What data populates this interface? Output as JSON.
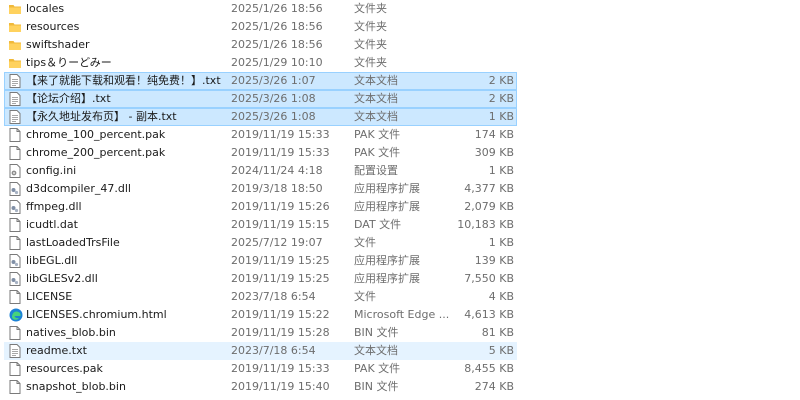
{
  "files": [
    {
      "name": "locales",
      "date": "2025/1/26 18:56",
      "type": "文件夹",
      "size": "",
      "icon": "folder-icon",
      "state": ""
    },
    {
      "name": "resources",
      "date": "2025/1/26 18:56",
      "type": "文件夹",
      "size": "",
      "icon": "folder-icon",
      "state": ""
    },
    {
      "name": "swiftshader",
      "date": "2025/1/26 18:56",
      "type": "文件夹",
      "size": "",
      "icon": "folder-icon",
      "state": ""
    },
    {
      "name": "tips＆りーどみー",
      "date": "2025/1/29 10:10",
      "type": "文件夹",
      "size": "",
      "icon": "folder-icon",
      "state": ""
    },
    {
      "name": "【来了就能下载和观看！纯免费！】.txt",
      "date": "2025/3/26 1:07",
      "type": "文本文档",
      "size": "2 KB",
      "icon": "text-file-icon",
      "state": "selected"
    },
    {
      "name": "【论坛介绍】.txt",
      "date": "2025/3/26 1:08",
      "type": "文本文档",
      "size": "2 KB",
      "icon": "text-file-icon",
      "state": "selected"
    },
    {
      "name": "【永久地址发布页】 - 副本.txt",
      "date": "2025/3/26 1:08",
      "type": "文本文档",
      "size": "1 KB",
      "icon": "text-file-icon",
      "state": "selected"
    },
    {
      "name": "chrome_100_percent.pak",
      "date": "2019/11/19 15:33",
      "type": "PAK 文件",
      "size": "174 KB",
      "icon": "file-icon",
      "state": ""
    },
    {
      "name": "chrome_200_percent.pak",
      "date": "2019/11/19 15:33",
      "type": "PAK 文件",
      "size": "309 KB",
      "icon": "file-icon",
      "state": ""
    },
    {
      "name": "config.ini",
      "date": "2024/11/24 4:18",
      "type": "配置设置",
      "size": "1 KB",
      "icon": "settings-file-icon",
      "state": ""
    },
    {
      "name": "d3dcompiler_47.dll",
      "date": "2019/3/18 18:50",
      "type": "应用程序扩展",
      "size": "4,377 KB",
      "icon": "dll-file-icon",
      "state": ""
    },
    {
      "name": "ffmpeg.dll",
      "date": "2019/11/19 15:26",
      "type": "应用程序扩展",
      "size": "2,079 KB",
      "icon": "dll-file-icon",
      "state": ""
    },
    {
      "name": "icudtl.dat",
      "date": "2019/11/19 15:15",
      "type": "DAT 文件",
      "size": "10,183 KB",
      "icon": "file-icon",
      "state": ""
    },
    {
      "name": "lastLoadedTrsFile",
      "date": "2025/7/12 19:07",
      "type": "文件",
      "size": "1 KB",
      "icon": "file-icon",
      "state": ""
    },
    {
      "name": "libEGL.dll",
      "date": "2019/11/19 15:25",
      "type": "应用程序扩展",
      "size": "139 KB",
      "icon": "dll-file-icon",
      "state": ""
    },
    {
      "name": "libGLESv2.dll",
      "date": "2019/11/19 15:25",
      "type": "应用程序扩展",
      "size": "7,550 KB",
      "icon": "dll-file-icon",
      "state": ""
    },
    {
      "name": "LICENSE",
      "date": "2023/7/18 6:54",
      "type": "文件",
      "size": "4 KB",
      "icon": "file-icon",
      "state": ""
    },
    {
      "name": "LICENSES.chromium.html",
      "date": "2019/11/19 15:22",
      "type": "Microsoft Edge ...",
      "size": "4,613 KB",
      "icon": "edge-html-icon",
      "state": ""
    },
    {
      "name": "natives_blob.bin",
      "date": "2019/11/19 15:28",
      "type": "BIN 文件",
      "size": "81 KB",
      "icon": "file-icon",
      "state": ""
    },
    {
      "name": "readme.txt",
      "date": "2023/7/18 6:54",
      "type": "文本文档",
      "size": "5 KB",
      "icon": "text-file-icon",
      "state": "hover"
    },
    {
      "name": "resources.pak",
      "date": "2019/11/19 15:33",
      "type": "PAK 文件",
      "size": "8,455 KB",
      "icon": "file-icon",
      "state": ""
    },
    {
      "name": "snapshot_blob.bin",
      "date": "2019/11/19 15:40",
      "type": "BIN 文件",
      "size": "274 KB",
      "icon": "file-icon",
      "state": ""
    }
  ]
}
